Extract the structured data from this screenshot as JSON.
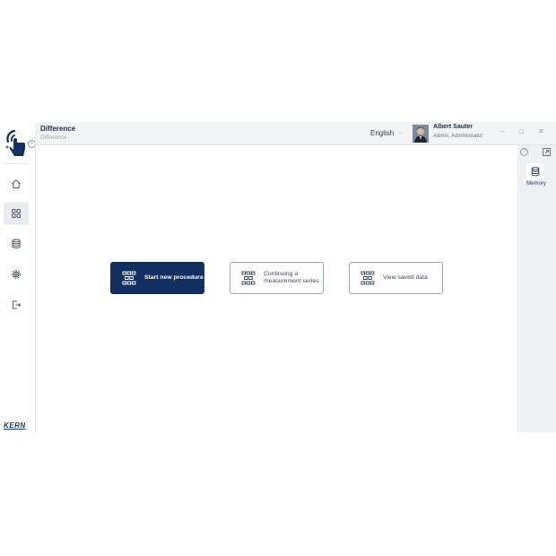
{
  "header": {
    "title": "Difference",
    "subtitle": "Difference",
    "language": "English",
    "user_name": "Albert Sauter",
    "user_role": "Admin, Administrator",
    "window_controls": {
      "minimize": "–",
      "maximize": "□",
      "close": "✕"
    }
  },
  "sidebar": {
    "toggle": "›",
    "items": [
      {
        "name": "home",
        "icon": "home-icon"
      },
      {
        "name": "apps",
        "icon": "grid-icon",
        "active": true
      },
      {
        "name": "database",
        "icon": "database-icon"
      },
      {
        "name": "settings",
        "icon": "gear-icon"
      },
      {
        "name": "logout",
        "icon": "logout-icon"
      }
    ],
    "brand": "KERN"
  },
  "main": {
    "cards": [
      {
        "label": "Start new procedure",
        "primary": true
      },
      {
        "label_line1": "Continuing a",
        "label_line2": "measurement series"
      },
      {
        "label": "View saved data"
      }
    ]
  },
  "right_panel": {
    "help": "?",
    "memory_label": "Memory"
  },
  "colors": {
    "brand_navy": "#12305f",
    "header_bg": "#f2f3f5",
    "panel_bg": "#eef0f3"
  }
}
